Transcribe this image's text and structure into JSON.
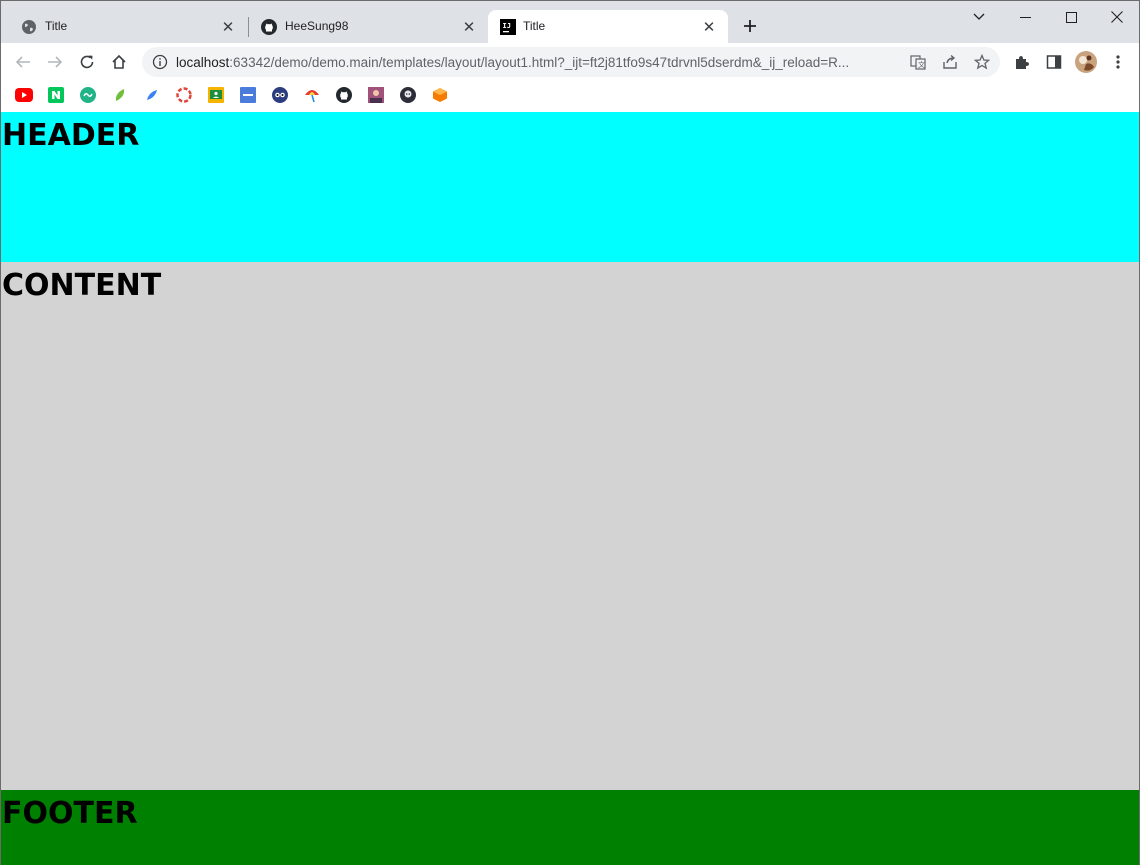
{
  "tabs": [
    {
      "title": "Title",
      "icon": "globe-icon",
      "active": false
    },
    {
      "title": "HeeSung98",
      "icon": "github-icon",
      "active": false
    },
    {
      "title": "Title",
      "icon": "intellij-icon",
      "active": true
    }
  ],
  "address_bar": {
    "host": "localhost",
    "rest": ":63342/demo/demo.main/templates/layout/layout1.html?_ijt=ft2j81tfo9s47tdrvnl5dserdm&_ij_reload=R..."
  },
  "bookmarks": [
    {
      "icon": "youtube-icon",
      "color": "#ff0000"
    },
    {
      "icon": "naver-icon",
      "color": "#03c75a"
    },
    {
      "icon": "green-circle-icon",
      "color": "#20b486"
    },
    {
      "icon": "leaf-icon",
      "color": "#6fbf3b"
    },
    {
      "icon": "blue-leaf-icon",
      "color": "#3b82f6"
    },
    {
      "icon": "lifebuoy-icon",
      "color": "#e0453a"
    },
    {
      "icon": "classroom-icon",
      "color": "#f4b400"
    },
    {
      "icon": "docs-blue-icon",
      "color": "#4a7cdc"
    },
    {
      "icon": "owl-icon",
      "color": "#2c3e80"
    },
    {
      "icon": "umbrella-icon",
      "color": "#e53935"
    },
    {
      "icon": "github-icon",
      "color": "#24292f"
    },
    {
      "icon": "photo-icon",
      "color": "#a0527a"
    },
    {
      "icon": "avatar-dark-icon",
      "color": "#2d2d3a"
    },
    {
      "icon": "orange-cube-icon",
      "color": "#f57c00"
    }
  ],
  "page": {
    "header": "HEADER",
    "content": "CONTENT",
    "footer": "FOOTER"
  },
  "colors": {
    "header_bg": "#00ffff",
    "content_bg": "#d3d3d3",
    "footer_bg": "#008000"
  }
}
